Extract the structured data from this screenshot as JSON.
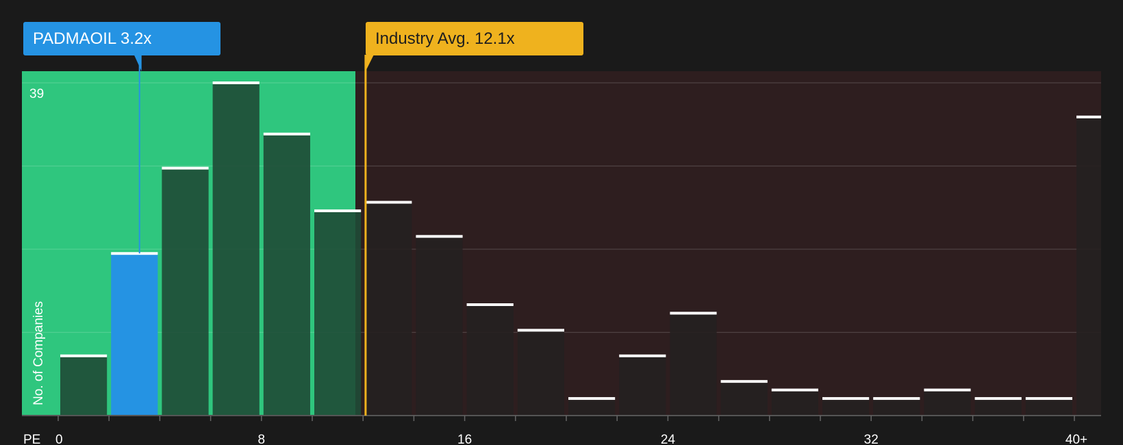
{
  "colors": {
    "background": "#1a1a1a",
    "subject": "#2593e3",
    "industry": "#efb21e",
    "undervalued_zone": "#2fc67e",
    "overvalued_zone": "#2e1e1f",
    "bar_in_green": "#1f4a36",
    "bar_in_red": "#252020",
    "bar_top": "#ffffff"
  },
  "callouts": {
    "subject_label": "PADMAOIL 3.2x",
    "industry_label": "Industry Avg. 12.1x"
  },
  "chart_data": {
    "type": "bar",
    "xlabel": "PE",
    "ylabel": "No. of Companies",
    "ylim": [
      0,
      40
    ],
    "ymax_label": "39",
    "bin_width": 2,
    "x_ticks": [
      0,
      8,
      16,
      24,
      32,
      40
    ],
    "x_tick_labels": [
      "0",
      "8",
      "16",
      "24",
      "32",
      "40+"
    ],
    "bins": [
      {
        "start": 0,
        "end": 2,
        "count": 7
      },
      {
        "start": 2,
        "end": 4,
        "count": 19
      },
      {
        "start": 4,
        "end": 6,
        "count": 29
      },
      {
        "start": 6,
        "end": 8,
        "count": 39
      },
      {
        "start": 8,
        "end": 10,
        "count": 33
      },
      {
        "start": 10,
        "end": 12,
        "count": 24
      },
      {
        "start": 12,
        "end": 14,
        "count": 25
      },
      {
        "start": 14,
        "end": 16,
        "count": 21
      },
      {
        "start": 16,
        "end": 18,
        "count": 13
      },
      {
        "start": 18,
        "end": 20,
        "count": 10
      },
      {
        "start": 20,
        "end": 22,
        "count": 2
      },
      {
        "start": 22,
        "end": 24,
        "count": 7
      },
      {
        "start": 24,
        "end": 26,
        "count": 12
      },
      {
        "start": 26,
        "end": 28,
        "count": 4
      },
      {
        "start": 28,
        "end": 30,
        "count": 3
      },
      {
        "start": 30,
        "end": 32,
        "count": 2
      },
      {
        "start": 32,
        "end": 34,
        "count": 2
      },
      {
        "start": 34,
        "end": 36,
        "count": 3
      },
      {
        "start": 36,
        "end": 38,
        "count": 2
      },
      {
        "start": 38,
        "end": 40,
        "count": 2
      },
      {
        "start": 40,
        "end": 41,
        "count": 35
      }
    ],
    "subject": {
      "name": "PADMAOIL",
      "value": 3.2
    },
    "industry_avg": 12.1,
    "undervalued_end": 11.7,
    "grid": true
  }
}
